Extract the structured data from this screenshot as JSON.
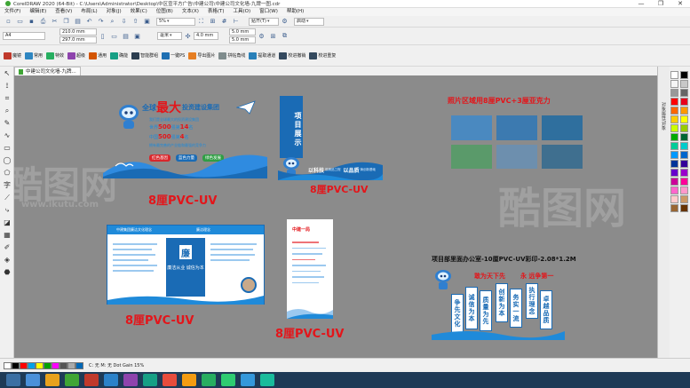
{
  "window": {
    "title": "CorelDRAW 2020 (64-Bit) - C:\\Users\\Administrator\\Desktop\\中区宣平方广告\\中建公司\\中建公司文化墙-九牌一图.cdr",
    "controls": [
      "—",
      "❐",
      "✕"
    ]
  },
  "menu": [
    "文件(F)",
    "编辑(E)",
    "查看(V)",
    "布局(L)",
    "对象(J)",
    "效果(C)",
    "位图(B)",
    "文本(X)",
    "表格(T)",
    "工具(O)",
    "窗口(W)",
    "帮助(H)"
  ],
  "toolbar1": {
    "zoom": "5%",
    "snap": "贴齐(T)",
    "launch": "启动"
  },
  "toolbar2": {
    "page_size": "A4",
    "width": "210.0 mm",
    "height": "297.0 mm",
    "units": "毫米",
    "nudge": "4.0 mm",
    "dup_x": "5.0 mm",
    "dup_y": "5.0 mm"
  },
  "toolbar3": [
    "魔镜",
    "常用",
    "特效",
    "超级",
    "通用",
    "确能",
    "智能群组",
    "一键PS",
    "导出图片",
    "拼帖角线",
    "提取通道",
    "校进撤销",
    "校进重复"
  ],
  "doc_tab": "中建公司文化墙-九牌...",
  "docker_label": "对象属性/对象",
  "status": {
    "text": "C: 无  M: 无  Dot Gain 15%"
  },
  "palette": [
    "#ffffff",
    "#000000",
    "#f5f5f5",
    "#c8c8c8",
    "#999999",
    "#666666",
    "#ff0000",
    "#e8001a",
    "#ff6600",
    "#ff9900",
    "#ffcc00",
    "#ffff00",
    "#ccff00",
    "#99cc00",
    "#00aa00",
    "#006633",
    "#00cc99",
    "#00cccc",
    "#0099ff",
    "#0066cc",
    "#003399",
    "#330099",
    "#6600cc",
    "#9900cc",
    "#cc0099",
    "#ff0099",
    "#ff66cc",
    "#ff99cc",
    "#ffcccc",
    "#cc9966",
    "#996633",
    "#663300"
  ],
  "status_swatches": [
    "#ffffff",
    "#000000",
    "#ff0000",
    "#00a0e9",
    "#ffff00",
    "#00a000",
    "#ff00ff",
    "#555555",
    "#aaaaaa",
    "#0068b7"
  ],
  "artwork": {
    "board1": {
      "label": "8厘PVC-UV",
      "big_char": "最大",
      "headline_pre": "全球",
      "headline_post": "投资建设集团",
      "line1": "我们是全球最大的投资建设集团",
      "line2a": "世界",
      "line2b": "500",
      "line2c": "强第",
      "line2d": "14",
      "line2e": "名",
      "line3a": "中国",
      "line3b": "500",
      "line3c": "强第",
      "line3d": "4",
      "line3e": "名",
      "line4": "拥有最完善的产业链和最强的竞争力",
      "pills": [
        "红色基因",
        "蓝色力量",
        "绿色发展"
      ]
    },
    "board2": {
      "label": "8厘PVC-UV",
      "vertical": "项目展示",
      "slogan1": "以科技",
      "slogan1b": "筑精品工程",
      "slogan2": "以品质",
      "slogan2b": "铸创新基础"
    },
    "board3": {
      "title": "照片区域用8厘PVC+3厘亚克力",
      "photos": [
        "#4a89c0",
        "#3c7ab0",
        "#2f6f9e",
        "#5a9a6a",
        "#6d8fae",
        "#3f6f8f"
      ]
    },
    "board4": {
      "label": "8厘PVC-UV",
      "header_left": "中建集团廉洁文化理念",
      "header_right": "廉洁理念",
      "banner": "廉洁从业 诚信为本",
      "slogan": "廉洁从业"
    },
    "board5": {
      "label": "8厘PVC-UV",
      "title": "中建一局"
    },
    "board6": {
      "title": "项目部里面办公室-10厘PVC-UV彩印-2.08*1.2M",
      "head_left": "敢为天下先",
      "head_right": "永 远争第一",
      "banners": [
        "争先文化",
        "诚信为本",
        "质量为先",
        "创新为本",
        "务实一流",
        "执行理念",
        "卓越品质"
      ]
    },
    "watermark": "酷图网",
    "watermark_url": "www.ikutu.com"
  }
}
